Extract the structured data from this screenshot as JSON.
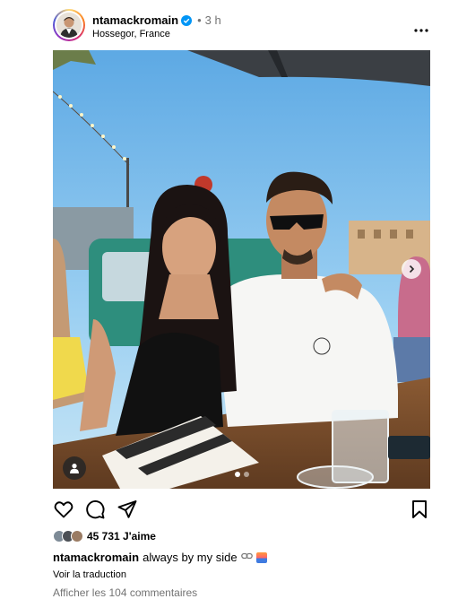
{
  "post": {
    "username": "ntamackromain",
    "time_separator": "•",
    "time_ago": "3 h",
    "location": "Hossegor, France",
    "likes_count": "45 731 J'aime",
    "caption_username": "ntamackromain",
    "caption_text": "always by my side",
    "translate_label": "Voir la traduction",
    "comments_label": "Afficher les 104 commentaires",
    "carousel": {
      "total": 2,
      "active": 1
    }
  },
  "icons": {
    "more": "more-options-icon",
    "verified": "verified-badge-icon",
    "like": "heart-icon",
    "comment": "comment-bubble-icon",
    "share": "paper-plane-icon",
    "save": "bookmark-icon",
    "tag": "user-tag-icon",
    "next": "chevron-right-icon",
    "link": "link-icon",
    "sunset": "sunset-emoji-icon"
  },
  "colors": {
    "verified": "#0095f6",
    "secondary_text": "#737373"
  }
}
